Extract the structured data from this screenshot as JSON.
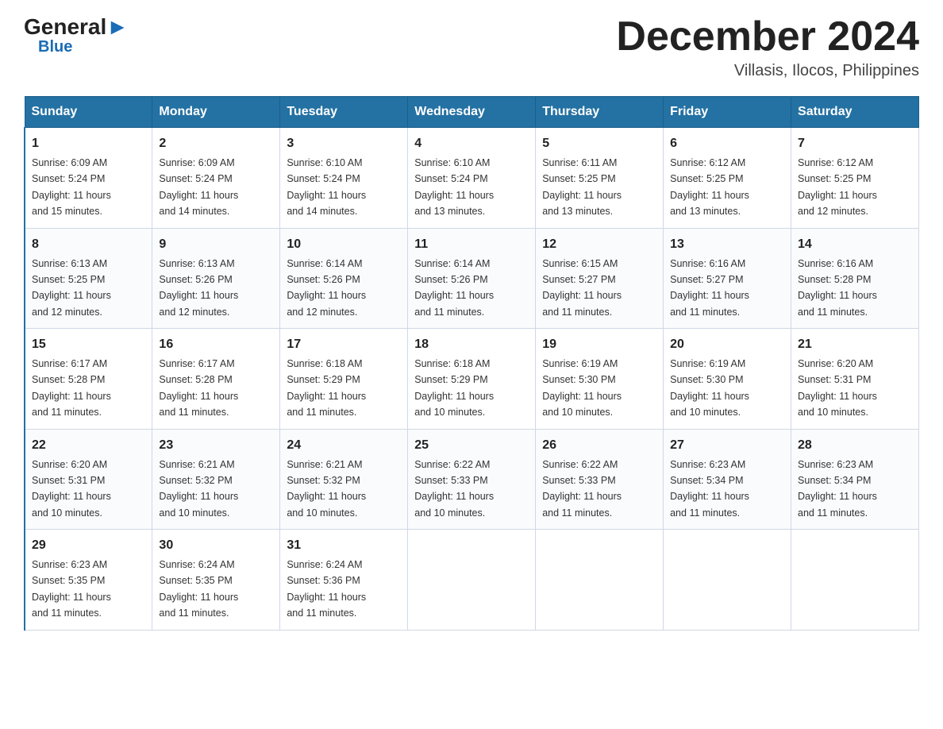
{
  "logo": {
    "general": "General",
    "blue": "Blue",
    "arrow": "▶"
  },
  "title": "December 2024",
  "location": "Villasis, Ilocos, Philippines",
  "days_header": [
    "Sunday",
    "Monday",
    "Tuesday",
    "Wednesday",
    "Thursday",
    "Friday",
    "Saturday"
  ],
  "weeks": [
    [
      {
        "day": "1",
        "sunrise": "6:09 AM",
        "sunset": "5:24 PM",
        "daylight": "11 hours and 15 minutes."
      },
      {
        "day": "2",
        "sunrise": "6:09 AM",
        "sunset": "5:24 PM",
        "daylight": "11 hours and 14 minutes."
      },
      {
        "day": "3",
        "sunrise": "6:10 AM",
        "sunset": "5:24 PM",
        "daylight": "11 hours and 14 minutes."
      },
      {
        "day": "4",
        "sunrise": "6:10 AM",
        "sunset": "5:24 PM",
        "daylight": "11 hours and 13 minutes."
      },
      {
        "day": "5",
        "sunrise": "6:11 AM",
        "sunset": "5:25 PM",
        "daylight": "11 hours and 13 minutes."
      },
      {
        "day": "6",
        "sunrise": "6:12 AM",
        "sunset": "5:25 PM",
        "daylight": "11 hours and 13 minutes."
      },
      {
        "day": "7",
        "sunrise": "6:12 AM",
        "sunset": "5:25 PM",
        "daylight": "11 hours and 12 minutes."
      }
    ],
    [
      {
        "day": "8",
        "sunrise": "6:13 AM",
        "sunset": "5:25 PM",
        "daylight": "11 hours and 12 minutes."
      },
      {
        "day": "9",
        "sunrise": "6:13 AM",
        "sunset": "5:26 PM",
        "daylight": "11 hours and 12 minutes."
      },
      {
        "day": "10",
        "sunrise": "6:14 AM",
        "sunset": "5:26 PM",
        "daylight": "11 hours and 12 minutes."
      },
      {
        "day": "11",
        "sunrise": "6:14 AM",
        "sunset": "5:26 PM",
        "daylight": "11 hours and 11 minutes."
      },
      {
        "day": "12",
        "sunrise": "6:15 AM",
        "sunset": "5:27 PM",
        "daylight": "11 hours and 11 minutes."
      },
      {
        "day": "13",
        "sunrise": "6:16 AM",
        "sunset": "5:27 PM",
        "daylight": "11 hours and 11 minutes."
      },
      {
        "day": "14",
        "sunrise": "6:16 AM",
        "sunset": "5:28 PM",
        "daylight": "11 hours and 11 minutes."
      }
    ],
    [
      {
        "day": "15",
        "sunrise": "6:17 AM",
        "sunset": "5:28 PM",
        "daylight": "11 hours and 11 minutes."
      },
      {
        "day": "16",
        "sunrise": "6:17 AM",
        "sunset": "5:28 PM",
        "daylight": "11 hours and 11 minutes."
      },
      {
        "day": "17",
        "sunrise": "6:18 AM",
        "sunset": "5:29 PM",
        "daylight": "11 hours and 11 minutes."
      },
      {
        "day": "18",
        "sunrise": "6:18 AM",
        "sunset": "5:29 PM",
        "daylight": "11 hours and 10 minutes."
      },
      {
        "day": "19",
        "sunrise": "6:19 AM",
        "sunset": "5:30 PM",
        "daylight": "11 hours and 10 minutes."
      },
      {
        "day": "20",
        "sunrise": "6:19 AM",
        "sunset": "5:30 PM",
        "daylight": "11 hours and 10 minutes."
      },
      {
        "day": "21",
        "sunrise": "6:20 AM",
        "sunset": "5:31 PM",
        "daylight": "11 hours and 10 minutes."
      }
    ],
    [
      {
        "day": "22",
        "sunrise": "6:20 AM",
        "sunset": "5:31 PM",
        "daylight": "11 hours and 10 minutes."
      },
      {
        "day": "23",
        "sunrise": "6:21 AM",
        "sunset": "5:32 PM",
        "daylight": "11 hours and 10 minutes."
      },
      {
        "day": "24",
        "sunrise": "6:21 AM",
        "sunset": "5:32 PM",
        "daylight": "11 hours and 10 minutes."
      },
      {
        "day": "25",
        "sunrise": "6:22 AM",
        "sunset": "5:33 PM",
        "daylight": "11 hours and 10 minutes."
      },
      {
        "day": "26",
        "sunrise": "6:22 AM",
        "sunset": "5:33 PM",
        "daylight": "11 hours and 11 minutes."
      },
      {
        "day": "27",
        "sunrise": "6:23 AM",
        "sunset": "5:34 PM",
        "daylight": "11 hours and 11 minutes."
      },
      {
        "day": "28",
        "sunrise": "6:23 AM",
        "sunset": "5:34 PM",
        "daylight": "11 hours and 11 minutes."
      }
    ],
    [
      {
        "day": "29",
        "sunrise": "6:23 AM",
        "sunset": "5:35 PM",
        "daylight": "11 hours and 11 minutes."
      },
      {
        "day": "30",
        "sunrise": "6:24 AM",
        "sunset": "5:35 PM",
        "daylight": "11 hours and 11 minutes."
      },
      {
        "day": "31",
        "sunrise": "6:24 AM",
        "sunset": "5:36 PM",
        "daylight": "11 hours and 11 minutes."
      },
      null,
      null,
      null,
      null
    ]
  ],
  "labels": {
    "sunrise": "Sunrise:",
    "sunset": "Sunset:",
    "daylight": "Daylight:"
  }
}
